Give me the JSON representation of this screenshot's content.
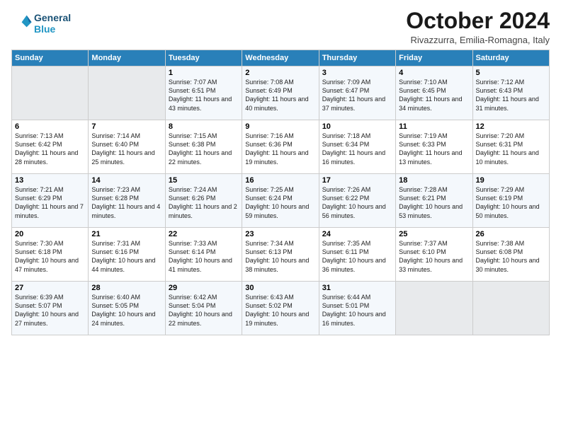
{
  "logo": {
    "line1": "General",
    "line2": "Blue"
  },
  "title": "October 2024",
  "location": "Rivazzurra, Emilia-Romagna, Italy",
  "weekdays": [
    "Sunday",
    "Monday",
    "Tuesday",
    "Wednesday",
    "Thursday",
    "Friday",
    "Saturday"
  ],
  "weeks": [
    [
      {
        "day": "",
        "info": ""
      },
      {
        "day": "",
        "info": ""
      },
      {
        "day": "1",
        "info": "Sunrise: 7:07 AM\nSunset: 6:51 PM\nDaylight: 11 hours and 43 minutes."
      },
      {
        "day": "2",
        "info": "Sunrise: 7:08 AM\nSunset: 6:49 PM\nDaylight: 11 hours and 40 minutes."
      },
      {
        "day": "3",
        "info": "Sunrise: 7:09 AM\nSunset: 6:47 PM\nDaylight: 11 hours and 37 minutes."
      },
      {
        "day": "4",
        "info": "Sunrise: 7:10 AM\nSunset: 6:45 PM\nDaylight: 11 hours and 34 minutes."
      },
      {
        "day": "5",
        "info": "Sunrise: 7:12 AM\nSunset: 6:43 PM\nDaylight: 11 hours and 31 minutes."
      }
    ],
    [
      {
        "day": "6",
        "info": "Sunrise: 7:13 AM\nSunset: 6:42 PM\nDaylight: 11 hours and 28 minutes."
      },
      {
        "day": "7",
        "info": "Sunrise: 7:14 AM\nSunset: 6:40 PM\nDaylight: 11 hours and 25 minutes."
      },
      {
        "day": "8",
        "info": "Sunrise: 7:15 AM\nSunset: 6:38 PM\nDaylight: 11 hours and 22 minutes."
      },
      {
        "day": "9",
        "info": "Sunrise: 7:16 AM\nSunset: 6:36 PM\nDaylight: 11 hours and 19 minutes."
      },
      {
        "day": "10",
        "info": "Sunrise: 7:18 AM\nSunset: 6:34 PM\nDaylight: 11 hours and 16 minutes."
      },
      {
        "day": "11",
        "info": "Sunrise: 7:19 AM\nSunset: 6:33 PM\nDaylight: 11 hours and 13 minutes."
      },
      {
        "day": "12",
        "info": "Sunrise: 7:20 AM\nSunset: 6:31 PM\nDaylight: 11 hours and 10 minutes."
      }
    ],
    [
      {
        "day": "13",
        "info": "Sunrise: 7:21 AM\nSunset: 6:29 PM\nDaylight: 11 hours and 7 minutes."
      },
      {
        "day": "14",
        "info": "Sunrise: 7:23 AM\nSunset: 6:28 PM\nDaylight: 11 hours and 4 minutes."
      },
      {
        "day": "15",
        "info": "Sunrise: 7:24 AM\nSunset: 6:26 PM\nDaylight: 11 hours and 2 minutes."
      },
      {
        "day": "16",
        "info": "Sunrise: 7:25 AM\nSunset: 6:24 PM\nDaylight: 10 hours and 59 minutes."
      },
      {
        "day": "17",
        "info": "Sunrise: 7:26 AM\nSunset: 6:22 PM\nDaylight: 10 hours and 56 minutes."
      },
      {
        "day": "18",
        "info": "Sunrise: 7:28 AM\nSunset: 6:21 PM\nDaylight: 10 hours and 53 minutes."
      },
      {
        "day": "19",
        "info": "Sunrise: 7:29 AM\nSunset: 6:19 PM\nDaylight: 10 hours and 50 minutes."
      }
    ],
    [
      {
        "day": "20",
        "info": "Sunrise: 7:30 AM\nSunset: 6:18 PM\nDaylight: 10 hours and 47 minutes."
      },
      {
        "day": "21",
        "info": "Sunrise: 7:31 AM\nSunset: 6:16 PM\nDaylight: 10 hours and 44 minutes."
      },
      {
        "day": "22",
        "info": "Sunrise: 7:33 AM\nSunset: 6:14 PM\nDaylight: 10 hours and 41 minutes."
      },
      {
        "day": "23",
        "info": "Sunrise: 7:34 AM\nSunset: 6:13 PM\nDaylight: 10 hours and 38 minutes."
      },
      {
        "day": "24",
        "info": "Sunrise: 7:35 AM\nSunset: 6:11 PM\nDaylight: 10 hours and 36 minutes."
      },
      {
        "day": "25",
        "info": "Sunrise: 7:37 AM\nSunset: 6:10 PM\nDaylight: 10 hours and 33 minutes."
      },
      {
        "day": "26",
        "info": "Sunrise: 7:38 AM\nSunset: 6:08 PM\nDaylight: 10 hours and 30 minutes."
      }
    ],
    [
      {
        "day": "27",
        "info": "Sunrise: 6:39 AM\nSunset: 5:07 PM\nDaylight: 10 hours and 27 minutes."
      },
      {
        "day": "28",
        "info": "Sunrise: 6:40 AM\nSunset: 5:05 PM\nDaylight: 10 hours and 24 minutes."
      },
      {
        "day": "29",
        "info": "Sunrise: 6:42 AM\nSunset: 5:04 PM\nDaylight: 10 hours and 22 minutes."
      },
      {
        "day": "30",
        "info": "Sunrise: 6:43 AM\nSunset: 5:02 PM\nDaylight: 10 hours and 19 minutes."
      },
      {
        "day": "31",
        "info": "Sunrise: 6:44 AM\nSunset: 5:01 PM\nDaylight: 10 hours and 16 minutes."
      },
      {
        "day": "",
        "info": ""
      },
      {
        "day": "",
        "info": ""
      }
    ]
  ]
}
